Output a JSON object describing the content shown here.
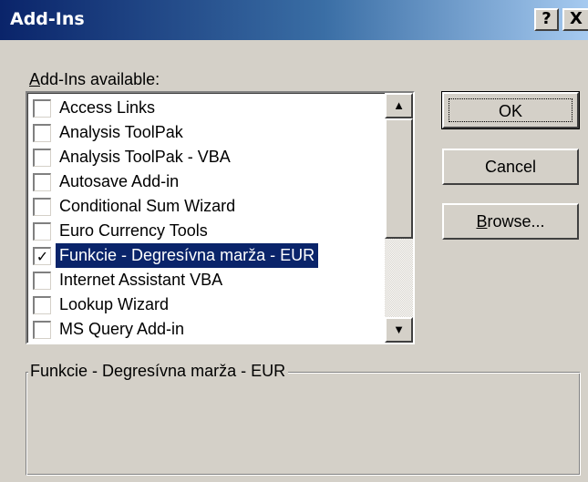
{
  "window": {
    "title": "Add-Ins",
    "help_label": "?",
    "close_label": "X"
  },
  "list_label": {
    "mnemonic": "A",
    "rest": "dd-Ins available:"
  },
  "items": [
    {
      "label": "Access Links",
      "checked": false,
      "selected": false,
      "mark": ""
    },
    {
      "label": "Analysis ToolPak",
      "checked": false,
      "selected": false,
      "mark": ""
    },
    {
      "label": "Analysis ToolPak - VBA",
      "checked": false,
      "selected": false,
      "mark": ""
    },
    {
      "label": "Autosave Add-in",
      "checked": false,
      "selected": false,
      "mark": ""
    },
    {
      "label": "Conditional Sum Wizard",
      "checked": false,
      "selected": false,
      "mark": ""
    },
    {
      "label": "Euro Currency Tools",
      "checked": false,
      "selected": false,
      "mark": ""
    },
    {
      "label": "Funkcie - Degresívna marža - EUR",
      "checked": true,
      "selected": true,
      "mark": "✓"
    },
    {
      "label": "Internet Assistant VBA",
      "checked": false,
      "selected": false,
      "mark": ""
    },
    {
      "label": "Lookup Wizard",
      "checked": false,
      "selected": false,
      "mark": ""
    },
    {
      "label": "MS Query Add-in",
      "checked": false,
      "selected": false,
      "mark": ""
    }
  ],
  "scrollbar": {
    "up_arrow": "▲",
    "down_arrow": "▼",
    "thumb_fraction": 0.6
  },
  "buttons": {
    "ok": "OK",
    "cancel": "Cancel",
    "browse_mnemonic": "B",
    "browse_rest": "rowse..."
  },
  "description": {
    "title": "Funkcie - Degresívna marža - EUR",
    "text": ""
  },
  "colors": {
    "title_bar": "#0a246a",
    "selection": "#0a246a",
    "face": "#d4d0c8"
  }
}
